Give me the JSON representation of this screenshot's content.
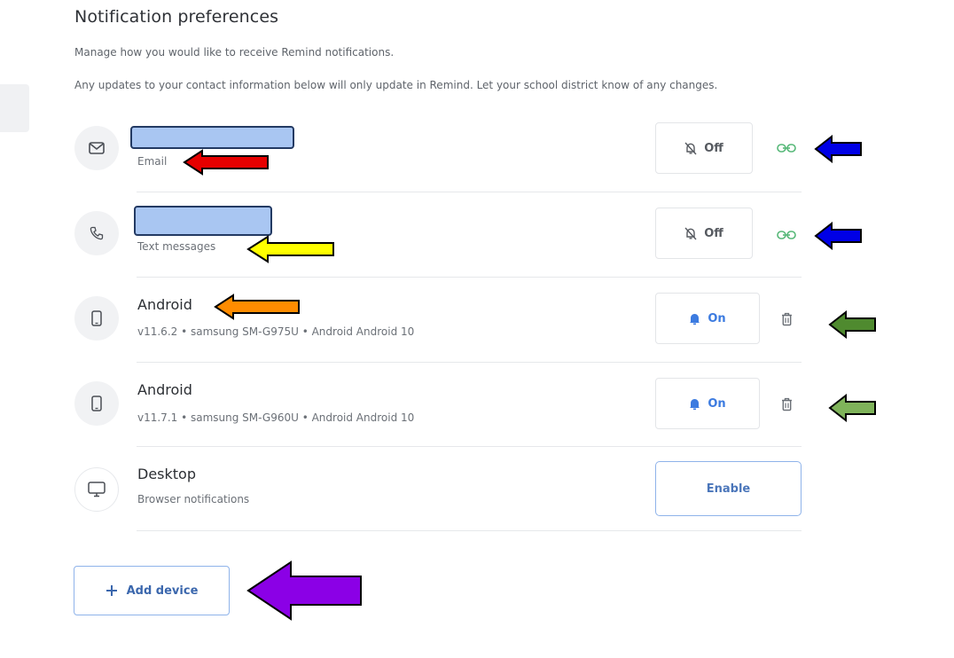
{
  "header": {
    "title": "Notification preferences",
    "subtitle_1": "Manage how you would like to receive Remind notifications.",
    "subtitle_2": "Any updates to your contact information below will only update in Remind. Let your school district know of any changes."
  },
  "channels": [
    {
      "icon": "mail-icon",
      "primary": "",
      "secondary": "Email",
      "toggle_label": "Off",
      "toggle_state": "off",
      "trailing_icon": "link-icon"
    },
    {
      "icon": "phone-icon",
      "primary": "",
      "secondary": "Text messages",
      "toggle_label": "Off",
      "toggle_state": "off",
      "trailing_icon": "link-icon"
    },
    {
      "icon": "mobile-device-icon",
      "primary": "Android",
      "secondary": "v11.6.2 • samsung SM-G975U • Android Android 10",
      "toggle_label": "On",
      "toggle_state": "on",
      "trailing_icon": "trash-icon"
    },
    {
      "icon": "mobile-device-icon",
      "primary": "Android",
      "secondary": "v11.7.1 • samsung SM-G960U • Android Android 10",
      "toggle_label": "On",
      "toggle_state": "on",
      "trailing_icon": "trash-icon"
    },
    {
      "icon": "desktop-icon",
      "primary": "Desktop",
      "secondary": "Browser notifications",
      "toggle_label": "Enable",
      "toggle_state": "enable",
      "trailing_icon": ""
    }
  ],
  "add_device": {
    "label": "Add device",
    "icon": "plus-icon"
  },
  "colors": {
    "accent": "#3c7be0",
    "link_green": "#56b878",
    "redaction": "#a9c6f2",
    "arrow_red": "#e60000",
    "arrow_yellow": "#ffff00",
    "arrow_orange": "#ff8c00",
    "arrow_blue": "#0000e6",
    "arrow_green_dark": "#4f8a2f",
    "arrow_green_light": "#7fb35a",
    "arrow_purple": "#8b00e6"
  }
}
